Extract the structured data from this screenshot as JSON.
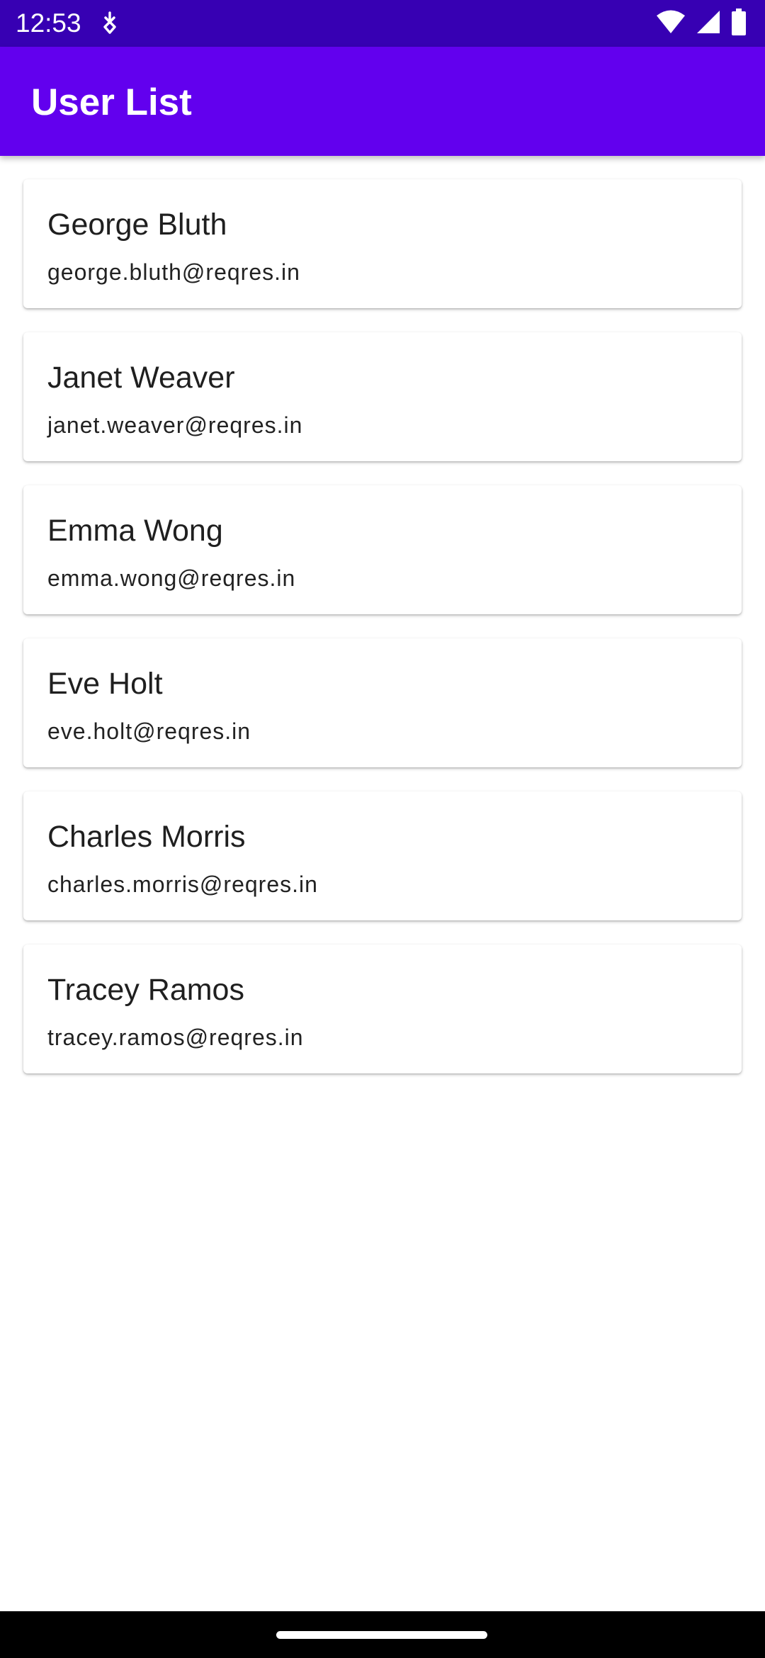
{
  "status_bar": {
    "time": "12:53",
    "icons": [
      "download-notification-icon",
      "wifi-icon",
      "cell-signal-icon",
      "battery-icon"
    ]
  },
  "app_bar": {
    "title": "User List"
  },
  "users": [
    {
      "name": "George Bluth",
      "email": "george.bluth@reqres.in"
    },
    {
      "name": "Janet Weaver",
      "email": "janet.weaver@reqres.in"
    },
    {
      "name": "Emma Wong",
      "email": "emma.wong@reqres.in"
    },
    {
      "name": "Eve Holt",
      "email": "eve.holt@reqres.in"
    },
    {
      "name": "Charles Morris",
      "email": "charles.morris@reqres.in"
    },
    {
      "name": "Tracey Ramos",
      "email": "tracey.ramos@reqres.in"
    }
  ],
  "colors": {
    "status_bar": "#3700b3",
    "app_bar": "#6200ee",
    "background": "#ffffff",
    "nav_bar": "#000000"
  }
}
